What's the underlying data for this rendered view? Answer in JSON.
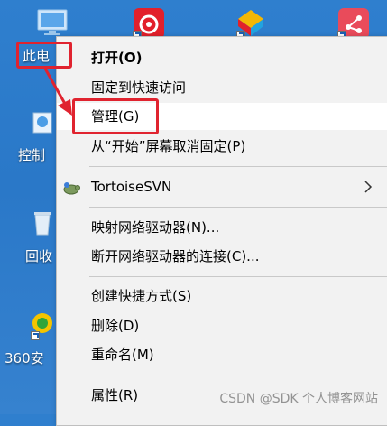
{
  "desktop": {
    "icons": [
      {
        "label": "此电",
        "name": "this-pc"
      },
      {
        "label": "控制",
        "name": "control-panel"
      },
      {
        "label": "回收",
        "name": "recycle-bin"
      },
      {
        "label": "360安",
        "name": "360-safe"
      }
    ],
    "top_icons": [
      "netease-cloud-music",
      "colored-app",
      "red-share-app"
    ]
  },
  "menu": {
    "items": [
      {
        "label": "打开(O)",
        "bold": true
      },
      {
        "label": "固定到快速访问"
      },
      {
        "label": "管理(G)",
        "highlighted": true
      },
      {
        "label": "从“开始”屏幕取消固定(P)"
      },
      {
        "label": "TortoiseSVN",
        "submenu": true
      },
      {
        "label": "映射网络驱动器(N)..."
      },
      {
        "label": "断开网络驱动器的连接(C)..."
      },
      {
        "label": "创建快捷方式(S)"
      },
      {
        "label": "删除(D)"
      },
      {
        "label": "重命名(M)"
      },
      {
        "label": "属性(R)"
      }
    ]
  },
  "watermark": "CSDN @SDK 个人博客网站",
  "colors": {
    "desktop_bg": "#2f7fce",
    "menu_bg": "#f2f2f2",
    "annotation_red": "#e0232f"
  }
}
